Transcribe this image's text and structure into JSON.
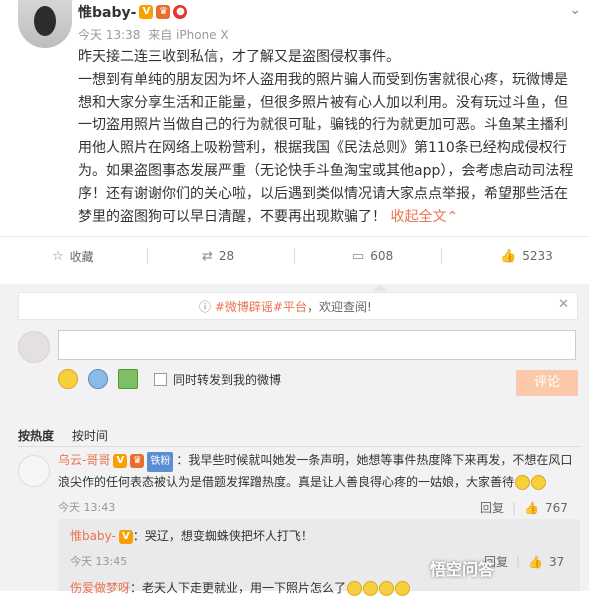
{
  "post": {
    "username": "惟baby-",
    "time": "今天 13:38",
    "source": "来自 iPhone X",
    "paragraph1": "昨天接二连三收到私信，才了解又是盗图侵权事件。",
    "paragraph2": "一想到有单纯的朋友因为坏人盗用我的照片骗人而受到伤害就很心疼，玩微博是想和大家分享生活和正能量，但很多照片被有心人加以利用。没有玩过斗鱼，但一切盗用照片当做自己的行为就很可耻，骗钱的行为就更加可恶。斗鱼某主播利用他人照片在网络上吸粉营利，根据我国《民法总则》第110条已经构成侵权行为。如果盗图事态发展严重（无论快手斗鱼淘宝或其他app），会考虑启动司法程序！还有谢谢你们的关心啦，以后遇到类似情况请大家点点举报，希望那些活在梦里的盗图狗可以早日清醒，不要再出现欺骗了！",
    "collapse": "收起全文"
  },
  "actions": {
    "favorite": "收藏",
    "repost": "28",
    "comment": "608",
    "like": "5233"
  },
  "notice": {
    "tag": "#微博辟谣#平台",
    "text": "，欢迎查阅!"
  },
  "compose": {
    "checkbox_label": "同时转发到我的微博",
    "submit": "评论"
  },
  "sort": {
    "hot": "按热度",
    "time": "按时间"
  },
  "comment1": {
    "user": "乌云-哥哥",
    "fan_tag": "铁粉",
    "text": "：我早些时候就叫她发一条声明，她想等事件热度降下来再发，不想在风口浪尖作的任何表态被认为是借题发挥蹭热度。真是让人善良得心疼的一姑娘，大家善待",
    "time": "今天 13:43",
    "reply": "回复",
    "likes": "767"
  },
  "reply1": {
    "user": "惟baby-",
    "text": "：哭辽，想变蜘蛛侠把坏人打飞！",
    "time": "今天 13:45",
    "reply": "回复",
    "likes": "37"
  },
  "reply2": {
    "user": "伤爱做梦呀",
    "text": "：老天人下走更就业，用一下照片怎么了"
  },
  "watermark": "悟空问答"
}
